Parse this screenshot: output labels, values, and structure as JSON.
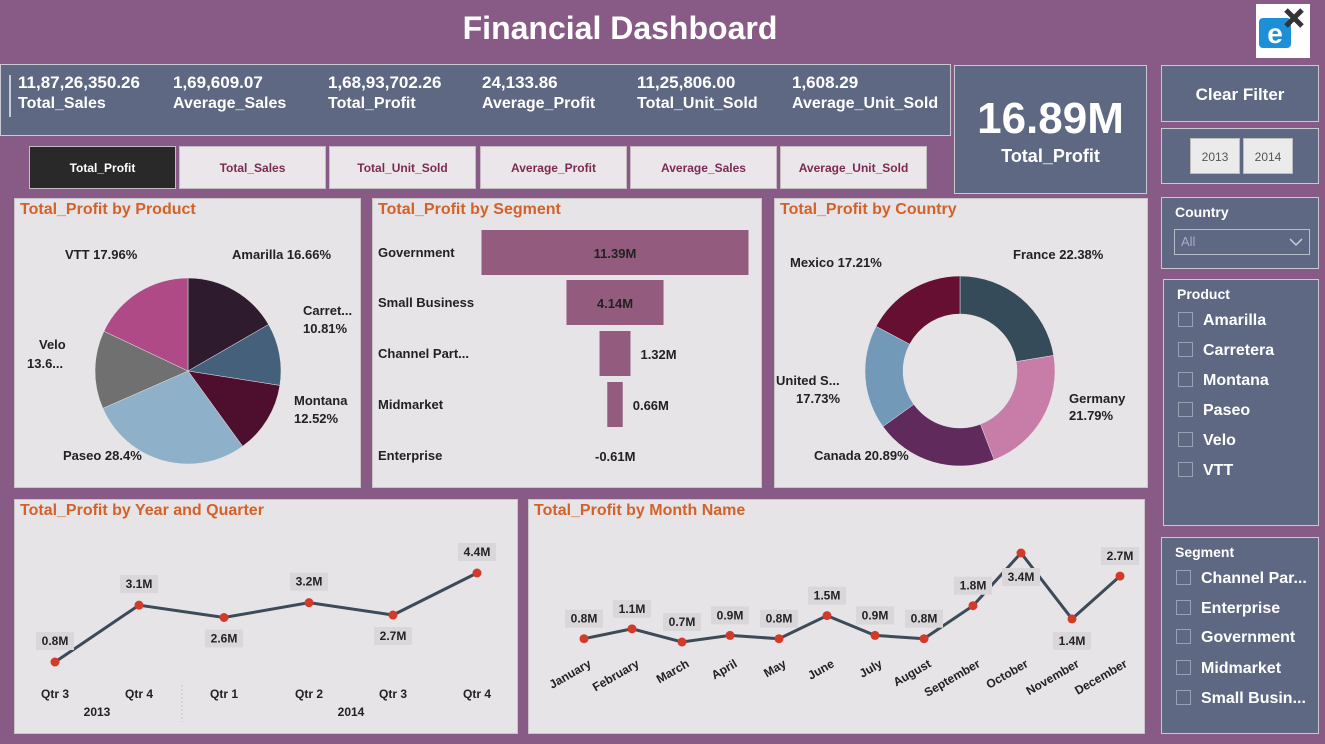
{
  "title": "Financial Dashboard",
  "kpis": [
    {
      "value": "11,87,26,350.26",
      "label": "Total_Sales"
    },
    {
      "value": "1,69,609.07",
      "label": "Average_Sales"
    },
    {
      "value": "1,68,93,702.26",
      "label": "Total_Profit"
    },
    {
      "value": "24,133.86",
      "label": "Average_Profit"
    },
    {
      "value": "11,25,806.00",
      "label": "Total_Unit_Sold"
    },
    {
      "value": "1,608.29",
      "label": "Average_Unit_Sold"
    }
  ],
  "big_card": {
    "value": "16.89M",
    "label": "Total_Profit"
  },
  "measure_buttons": [
    "Total_Profit",
    "Total_Sales",
    "Total_Unit_Sold",
    "Average_Profit",
    "Average_Sales",
    "Average_Unit_Sold"
  ],
  "clear_filter": "Clear Filter",
  "years": [
    "2013",
    "2014"
  ],
  "country_slicer": {
    "title": "Country",
    "selected": "All"
  },
  "product_slicer": {
    "title": "Product",
    "items": [
      "Amarilla",
      "Carretera",
      "Montana",
      "Paseo",
      "Velo",
      "VTT"
    ]
  },
  "segment_slicer": {
    "title": "Segment",
    "items": [
      "Channel Par...",
      "Enterprise",
      "Government",
      "Midmarket",
      "Small Busin..."
    ]
  },
  "colors": {
    "background": "#875b85",
    "card": "#5e6882",
    "accent": "#d4612a",
    "line": "#3d4a58",
    "marker": "#d23a2a",
    "bar": "#935c7f"
  },
  "chart_data": [
    {
      "type": "pie",
      "title": "Total_Profit by Product",
      "categories": [
        "Amarilla",
        "Carretera",
        "Montana",
        "Paseo",
        "Velo",
        "VTT"
      ],
      "values": [
        16.66,
        10.81,
        12.52,
        28.4,
        13.6,
        17.96
      ],
      "labels": [
        "Amarilla 16.66%",
        "Carret...",
        "10.81%",
        "Montana",
        "12.52%",
        "Paseo 28.4%",
        "Velo",
        "13.6...",
        "VTT 17.96%"
      ],
      "colors": [
        "#2e1b2e",
        "#44607a",
        "#4d0f2d",
        "#8eb0c8",
        "#707070",
        "#b04a86"
      ]
    },
    {
      "type": "bar",
      "title": "Total_Profit by Segment",
      "categories": [
        "Government",
        "Small Business",
        "Channel Part...",
        "Midmarket",
        "Enterprise"
      ],
      "values": [
        11.39,
        4.14,
        1.32,
        0.66,
        -0.61
      ],
      "data_labels": [
        "11.39M",
        "4.14M",
        "1.32M",
        "0.66M",
        "-0.61M"
      ]
    },
    {
      "type": "pie",
      "title": "Total_Profit by Country",
      "categories": [
        "France",
        "Germany",
        "Canada",
        "United States",
        "Mexico"
      ],
      "values": [
        22.38,
        21.79,
        20.89,
        17.73,
        17.21
      ],
      "labels": [
        "France 22.38%",
        "Germany",
        "21.79%",
        "Canada 20.89%",
        "United S...",
        "17.73%",
        "Mexico 17.21%"
      ],
      "colors": [
        "#354b5a",
        "#c87ca8",
        "#612a5d",
        "#7399b9",
        "#660f33"
      ]
    },
    {
      "type": "line",
      "title": "Total_Profit by Year and Quarter",
      "x": [
        "Qtr 3",
        "Qtr 4",
        "Qtr 1",
        "Qtr 2",
        "Qtr 3",
        "Qtr 4"
      ],
      "groups": [
        "2013",
        "2014"
      ],
      "values": [
        0.8,
        3.1,
        2.6,
        3.2,
        2.7,
        4.4
      ],
      "data_labels": [
        "0.8M",
        "3.1M",
        "2.6M",
        "3.2M",
        "2.7M",
        "4.4M"
      ]
    },
    {
      "type": "line",
      "title": "Total_Profit by Month Name",
      "x": [
        "January",
        "February",
        "March",
        "April",
        "May",
        "June",
        "July",
        "August",
        "September",
        "October",
        "November",
        "December"
      ],
      "values": [
        0.8,
        1.1,
        0.7,
        0.9,
        0.8,
        1.5,
        0.9,
        0.8,
        1.8,
        3.4,
        1.4,
        2.7
      ],
      "data_labels": [
        "0.8M",
        "1.1M",
        "0.7M",
        "0.9M",
        "0.8M",
        "1.5M",
        "0.9M",
        "0.8M",
        "1.8M",
        "3.4M",
        "1.4M",
        "2.7M"
      ]
    }
  ]
}
